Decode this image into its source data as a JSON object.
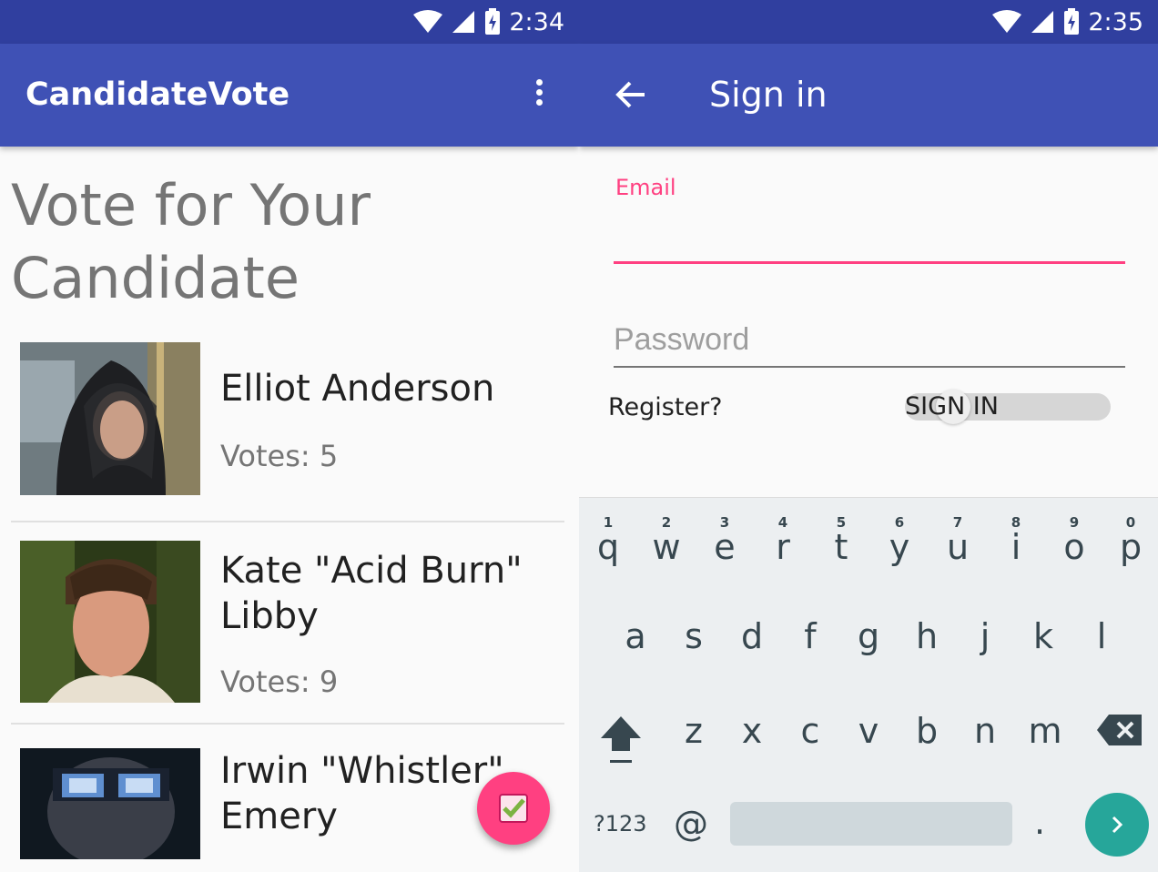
{
  "left_screen": {
    "status_time": "2:34",
    "app_title": "CandidateVote",
    "heading": "Vote for Your Candidate",
    "candidates": [
      {
        "name": "Elliot Anderson",
        "votes": "Votes: 5"
      },
      {
        "name": "Kate \"Acid Burn\" Libby",
        "votes": "Votes: 9"
      },
      {
        "name": "Irwin \"Whistler\" Emery",
        "votes": ""
      }
    ]
  },
  "right_screen": {
    "status_time": "2:35",
    "title": "Sign in",
    "email_label": "Email",
    "email_value": "",
    "password_placeholder": "Password",
    "register_label": "Register?",
    "sign_in_label": "SIGN IN",
    "keyboard": {
      "row1": [
        "q",
        "w",
        "e",
        "r",
        "t",
        "y",
        "u",
        "i",
        "o",
        "p"
      ],
      "row1_hints": [
        "1",
        "2",
        "3",
        "4",
        "5",
        "6",
        "7",
        "8",
        "9",
        "0"
      ],
      "row2": [
        "a",
        "s",
        "d",
        "f",
        "g",
        "h",
        "j",
        "k",
        "l"
      ],
      "row3": [
        "z",
        "x",
        "c",
        "v",
        "b",
        "n",
        "m"
      ],
      "symbols_label": "?123",
      "at_label": "@",
      "period_label": "."
    }
  },
  "colors": {
    "primary": "#3f51b5",
    "primary_dark": "#303f9f",
    "accent": "#ff4081",
    "keyboard_enter": "#26a69a"
  }
}
